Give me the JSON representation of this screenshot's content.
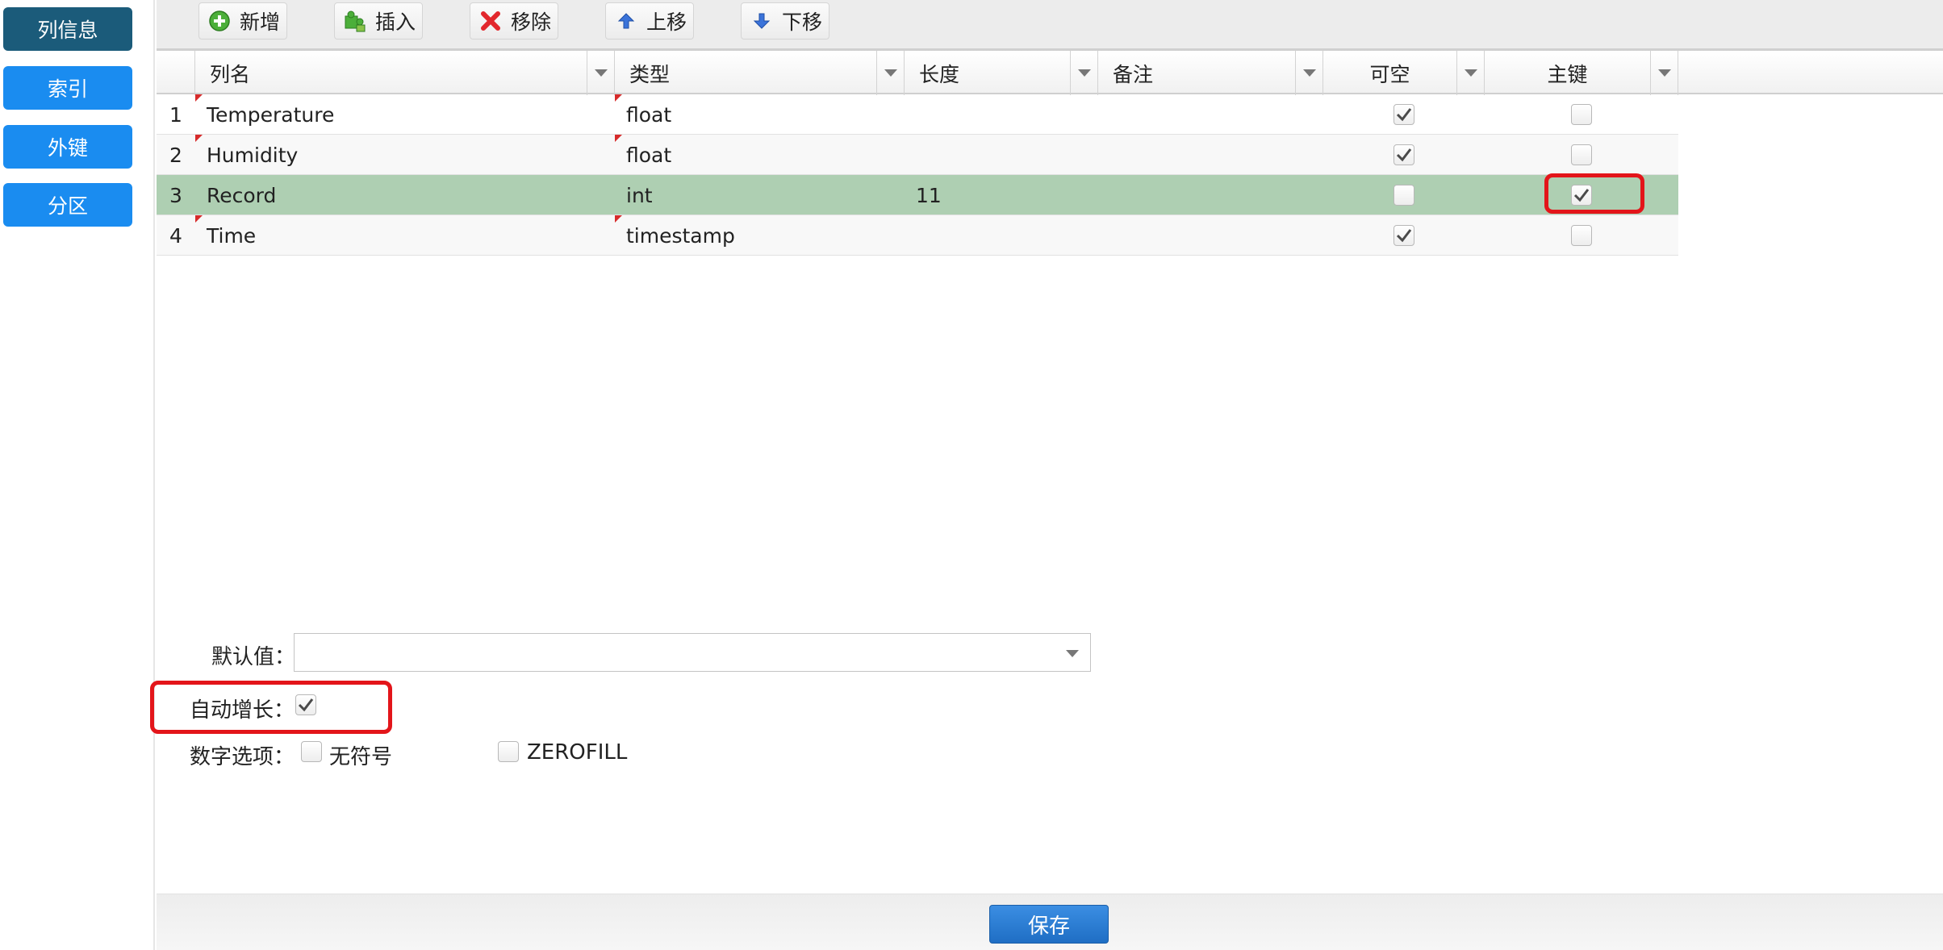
{
  "sidebar": {
    "items": [
      {
        "label": "列信息",
        "active": true
      },
      {
        "label": "索引"
      },
      {
        "label": "外键"
      },
      {
        "label": "分区"
      }
    ]
  },
  "toolbar": {
    "add_label": "新增",
    "insert_label": "插入",
    "remove_label": "移除",
    "move_up_label": "上移",
    "move_down_label": "下移"
  },
  "grid": {
    "headers": {
      "name": "列名",
      "type": "类型",
      "length": "长度",
      "comment": "备注",
      "nullable": "可空",
      "primary_key": "主键"
    },
    "rows": [
      {
        "index": "1",
        "name": "Temperature",
        "type": "float",
        "length": "",
        "comment": "",
        "nullable": true,
        "primary_key": false
      },
      {
        "index": "2",
        "name": "Humidity",
        "type": "float",
        "length": "",
        "comment": "",
        "nullable": true,
        "primary_key": false
      },
      {
        "index": "3",
        "name": "Record",
        "type": "int",
        "length": "11",
        "comment": "",
        "nullable": false,
        "primary_key": true,
        "selected": true
      },
      {
        "index": "4",
        "name": "Time",
        "type": "timestamp",
        "length": "",
        "comment": "",
        "nullable": true,
        "primary_key": false
      }
    ]
  },
  "form": {
    "default_label": "默认值：",
    "default_value": "",
    "auto_increment_label": "自动增长：",
    "auto_increment": true,
    "numeric_label": "数字选项：",
    "unsigned_label": "无符号",
    "unsigned": false,
    "zerofill_label": "ZEROFILL",
    "zerofill": false
  },
  "footer": {
    "save_label": "保存"
  },
  "colors": {
    "sidebar_active": "#1b5b7a",
    "sidebar_button": "#1a8cf0",
    "row_selected": "#aecfb2",
    "highlight": "#e3151a",
    "save_button": "#2a7fd6"
  }
}
